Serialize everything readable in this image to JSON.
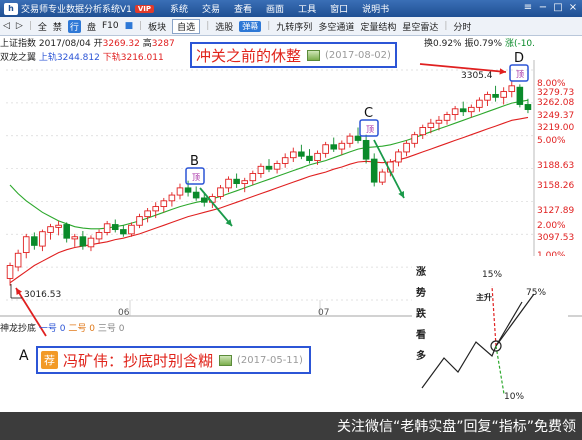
{
  "app": {
    "title": "交易师专业数据分析系统V1",
    "vip": "VIP",
    "logo": "h",
    "menus": [
      "系统",
      "交易",
      "查看",
      "画面",
      "工具",
      "窗口",
      "说明书"
    ],
    "window_controls": [
      "≡",
      "−",
      "□",
      "×"
    ]
  },
  "toolbar": {
    "items": [
      "全",
      "禁",
      "行",
      "盘",
      "F10",
      "■",
      "板块",
      "自选",
      "选股",
      "弹幕",
      "九转序列",
      "多空通道",
      "定量结构",
      "星空雷达",
      "分时"
    ],
    "active_index": 2,
    "badge_index": 9,
    "select_index": 7,
    "arrows": [
      "◁",
      "▷"
    ]
  },
  "info": {
    "index_name": "上证指数",
    "date": "2017/08/04",
    "open_label": "开",
    "open_value": "3269.32",
    "high_label": "高",
    "high_value": "3287",
    "turnover": "换0.92%",
    "amplitude": "振0.79%",
    "change": "涨(-10.",
    "indicator_name": "双龙之翼",
    "upper_label": "上轨",
    "upper_value": "3244.812",
    "lower_label": "下轨",
    "lower_value": "3216.011"
  },
  "price_axis": [
    "8.00%",
    "3279.73",
    "3262.08",
    "3249.37",
    "3219.00",
    "5.00%",
    "3188.63",
    "3158.26",
    "3127.89",
    "2.00%",
    "3097.53",
    "1.00%"
  ],
  "current_price_label": "3305.4",
  "low_label": "3016.53",
  "months": [
    "06",
    "07"
  ],
  "lower_indicator": {
    "name": "神龙抄底",
    "items": [
      "一号 0",
      "二号 0",
      "三号 0"
    ]
  },
  "notes": {
    "top": {
      "text": "冲关之前的休整",
      "date": "(2017-08-02)"
    },
    "bottom": {
      "badge": "荐",
      "text": "冯矿伟：抄底时别含糊",
      "date": "(2017-05-11)"
    }
  },
  "markers": {
    "A": "A",
    "B": "B",
    "C": "C",
    "D": "D",
    "box_text": "顶"
  },
  "diagram": {
    "side_text": [
      "涨",
      "势",
      "跌",
      "看",
      "多"
    ],
    "main_label": "主升",
    "p_up": "15%",
    "p_right": "75%",
    "p_down": "10%"
  },
  "colors": {
    "up": "#e02020",
    "down": "#0a8a2a",
    "ma_red": "#e02020",
    "ma_green": "#2da82d",
    "note_border": "#2c55d6"
  },
  "chart_data": {
    "type": "candlestick",
    "candles": [
      [
        3030,
        3052,
        3020,
        3048
      ],
      [
        3046,
        3070,
        3040,
        3065
      ],
      [
        3066,
        3092,
        3058,
        3088
      ],
      [
        3088,
        3094,
        3070,
        3076
      ],
      [
        3075,
        3098,
        3068,
        3095
      ],
      [
        3094,
        3106,
        3084,
        3102
      ],
      [
        3101,
        3110,
        3090,
        3104
      ],
      [
        3105,
        3108,
        3080,
        3086
      ],
      [
        3085,
        3092,
        3074,
        3088
      ],
      [
        3088,
        3096,
        3070,
        3075
      ],
      [
        3074,
        3090,
        3068,
        3086
      ],
      [
        3085,
        3098,
        3078,
        3094
      ],
      [
        3094,
        3110,
        3090,
        3106
      ],
      [
        3105,
        3112,
        3094,
        3098
      ],
      [
        3098,
        3104,
        3088,
        3092
      ],
      [
        3092,
        3108,
        3088,
        3104
      ],
      [
        3104,
        3120,
        3100,
        3116
      ],
      [
        3116,
        3128,
        3108,
        3124
      ],
      [
        3124,
        3136,
        3114,
        3130
      ],
      [
        3130,
        3142,
        3122,
        3138
      ],
      [
        3138,
        3150,
        3130,
        3146
      ],
      [
        3146,
        3162,
        3140,
        3156
      ],
      [
        3156,
        3166,
        3144,
        3150
      ],
      [
        3150,
        3158,
        3138,
        3142
      ],
      [
        3142,
        3150,
        3130,
        3136
      ],
      [
        3136,
        3148,
        3128,
        3144
      ],
      [
        3144,
        3160,
        3140,
        3156
      ],
      [
        3156,
        3172,
        3150,
        3168
      ],
      [
        3168,
        3176,
        3156,
        3162
      ],
      [
        3162,
        3170,
        3150,
        3166
      ],
      [
        3166,
        3180,
        3160,
        3176
      ],
      [
        3176,
        3190,
        3170,
        3186
      ],
      [
        3186,
        3196,
        3178,
        3182
      ],
      [
        3182,
        3194,
        3176,
        3190
      ],
      [
        3190,
        3204,
        3184,
        3198
      ],
      [
        3198,
        3212,
        3192,
        3206
      ],
      [
        3206,
        3216,
        3196,
        3200
      ],
      [
        3200,
        3210,
        3190,
        3194
      ],
      [
        3194,
        3208,
        3188,
        3204
      ],
      [
        3204,
        3220,
        3198,
        3216
      ],
      [
        3216,
        3226,
        3206,
        3210
      ],
      [
        3210,
        3222,
        3202,
        3218
      ],
      [
        3218,
        3232,
        3212,
        3228
      ],
      [
        3228,
        3240,
        3218,
        3222
      ],
      [
        3222,
        3230,
        3190,
        3196
      ],
      [
        3196,
        3204,
        3158,
        3164
      ],
      [
        3164,
        3182,
        3160,
        3178
      ],
      [
        3178,
        3196,
        3172,
        3192
      ],
      [
        3192,
        3210,
        3186,
        3206
      ],
      [
        3206,
        3222,
        3200,
        3218
      ],
      [
        3218,
        3234,
        3212,
        3230
      ],
      [
        3230,
        3244,
        3224,
        3240
      ],
      [
        3240,
        3252,
        3232,
        3246
      ],
      [
        3246,
        3256,
        3236,
        3250
      ],
      [
        3250,
        3262,
        3244,
        3258
      ],
      [
        3258,
        3270,
        3250,
        3266
      ],
      [
        3266,
        3276,
        3256,
        3262
      ],
      [
        3262,
        3272,
        3254,
        3268
      ],
      [
        3268,
        3282,
        3262,
        3278
      ],
      [
        3278,
        3290,
        3270,
        3286
      ],
      [
        3286,
        3298,
        3276,
        3282
      ],
      [
        3282,
        3296,
        3272,
        3290
      ],
      [
        3290,
        3305,
        3282,
        3298
      ],
      [
        3296,
        3300,
        3268,
        3272
      ],
      [
        3272,
        3280,
        3260,
        3265
      ]
    ],
    "ma_red": [
      3024,
      3032,
      3040,
      3048,
      3054,
      3060,
      3066,
      3070,
      3073,
      3075,
      3077,
      3079,
      3081,
      3084,
      3086,
      3089,
      3092,
      3096,
      3100,
      3104,
      3108,
      3112,
      3116,
      3119,
      3122,
      3125,
      3128,
      3132,
      3136,
      3140,
      3144,
      3148,
      3152,
      3156,
      3160,
      3164,
      3168,
      3172,
      3175,
      3178,
      3182,
      3185,
      3189,
      3192,
      3193,
      3192,
      3191,
      3192,
      3195,
      3198,
      3202,
      3206,
      3210,
      3214,
      3218,
      3222,
      3226,
      3230,
      3234,
      3238,
      3242,
      3246,
      3250,
      3252,
      3254
    ],
    "ma_green": [
      3160,
      3148,
      3138,
      3130,
      3122,
      3116,
      3110,
      3106,
      3102,
      3100,
      3099,
      3099,
      3100,
      3102,
      3104,
      3107,
      3110,
      3114,
      3118,
      3122,
      3126,
      3130,
      3133,
      3136,
      3138,
      3141,
      3144,
      3148,
      3152,
      3156,
      3160,
      3164,
      3168,
      3172,
      3176,
      3180,
      3184,
      3188,
      3191,
      3194,
      3198,
      3202,
      3206,
      3210,
      3212,
      3213,
      3214,
      3216,
      3219,
      3222,
      3226,
      3230,
      3234,
      3238,
      3242,
      3246,
      3250,
      3254,
      3258,
      3262,
      3266,
      3270,
      3274,
      3276,
      3278
    ],
    "ylim": [
      3000,
      3320
    ]
  }
}
